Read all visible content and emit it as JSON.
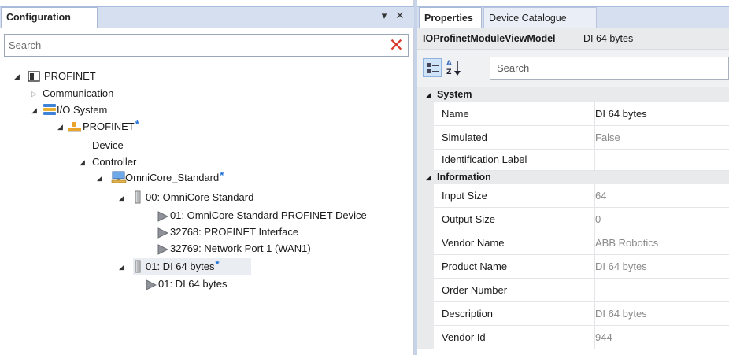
{
  "left_panel": {
    "title": "Configuration",
    "pin_glyph": "▾",
    "close_glyph": "✕",
    "search": {
      "placeholder": "Search",
      "clear_glyph": "✕"
    },
    "tree": [
      {
        "id": "profinet-root",
        "label": "PROFINET",
        "icon": "profinet-root-icon",
        "state": "expanded",
        "starred": false
      },
      {
        "id": "communication",
        "label": "Communication",
        "icon": "",
        "state": "collapsed",
        "starred": false
      },
      {
        "id": "io-system",
        "label": "I/O System",
        "icon": "io-system-icon",
        "state": "expanded",
        "starred": false
      },
      {
        "id": "profinet-network",
        "label": "PROFINET",
        "icon": "network-icon",
        "state": "expanded",
        "starred": true
      },
      {
        "id": "device",
        "label": "Device",
        "icon": "",
        "state": "none",
        "starred": false
      },
      {
        "id": "controller",
        "label": "Controller",
        "icon": "",
        "state": "expanded",
        "starred": false
      },
      {
        "id": "omnicore",
        "label": "OmniCore_Standard",
        "icon": "computer-icon",
        "state": "expanded",
        "starred": true
      },
      {
        "id": "slot-00",
        "label": "00: OmniCore Standard",
        "icon": "module-icon",
        "state": "expanded",
        "starred": false
      },
      {
        "id": "sub-01",
        "label": "01: OmniCore Standard PROFINET Device",
        "icon": "submodule-icon",
        "state": "none",
        "starred": false
      },
      {
        "id": "sub-32768",
        "label": "32768: PROFINET Interface",
        "icon": "submodule-icon",
        "state": "none",
        "starred": false
      },
      {
        "id": "sub-32769",
        "label": "32769: Network Port 1 (WAN1)",
        "icon": "submodule-icon",
        "state": "none",
        "starred": false
      },
      {
        "id": "slot-01",
        "label": "01: DI 64 bytes",
        "icon": "module-icon",
        "state": "expanded",
        "starred": true,
        "selected": true
      },
      {
        "id": "sub-di",
        "label": "01: DI 64 bytes",
        "icon": "submodule-icon",
        "state": "none",
        "starred": false
      }
    ],
    "star_glyph": "*"
  },
  "right_panel": {
    "tabs": [
      {
        "label": "Properties",
        "active": true
      },
      {
        "label": "Device Catalogue",
        "active": false
      }
    ],
    "view_model": {
      "name": "IOProfinetModuleViewModel",
      "value": "DI 64 bytes"
    },
    "toolbar": {
      "search_placeholder": "Search",
      "sort_glyph": "A\nZ"
    },
    "categories": [
      {
        "label": "System",
        "properties": [
          {
            "name": "Name",
            "value": "DI 64 bytes",
            "editable": true
          },
          {
            "name": "Simulated",
            "value": "False",
            "editable": false
          },
          {
            "name": "Identification Label",
            "value": "",
            "editable": true
          }
        ]
      },
      {
        "label": "Information",
        "properties": [
          {
            "name": "Input Size",
            "value": "64",
            "editable": false
          },
          {
            "name": "Output Size",
            "value": "0",
            "editable": false
          },
          {
            "name": "Vendor Name",
            "value": "ABB Robotics",
            "editable": false
          },
          {
            "name": "Product Name",
            "value": "DI 64 bytes",
            "editable": false
          },
          {
            "name": "Order Number",
            "value": "",
            "editable": false
          },
          {
            "name": "Description",
            "value": "DI 64 bytes",
            "editable": false
          },
          {
            "name": "Vendor Id",
            "value": "944",
            "editable": false
          }
        ]
      }
    ]
  },
  "colors": {
    "header_bg": "#d5dff0",
    "star": "#1a6fd6",
    "clear_x": "#d93a2e",
    "readonly_text": "#8a8a8a"
  }
}
